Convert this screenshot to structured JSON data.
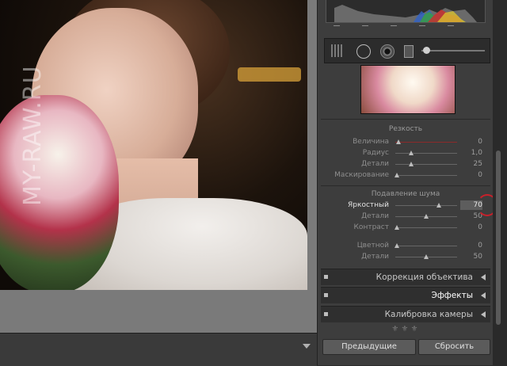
{
  "watermark": "MY-RAW.RU",
  "sharpening": {
    "title": "Резкость",
    "rows": [
      {
        "label": "Величина",
        "value": "0",
        "pos": 0.05,
        "red": true
      },
      {
        "label": "Радиус",
        "value": "1,0",
        "pos": 0.25,
        "red": false
      },
      {
        "label": "Детали",
        "value": "25",
        "pos": 0.25,
        "red": false
      },
      {
        "label": "Маскирование",
        "value": "0",
        "pos": 0.02,
        "red": false
      }
    ]
  },
  "noise": {
    "title": "Подавление шума",
    "rows": [
      {
        "label": "Яркостный",
        "value": "70",
        "pos": 0.7,
        "active": true
      },
      {
        "label": "Детали",
        "value": "50",
        "pos": 0.5,
        "active": false
      },
      {
        "label": "Контраст",
        "value": "0",
        "pos": 0.02,
        "active": false
      },
      {
        "label": "Цветной",
        "value": "0",
        "pos": 0.02,
        "active": false
      },
      {
        "label": "Детали",
        "value": "50",
        "pos": 0.5,
        "active": false
      }
    ]
  },
  "sections": [
    {
      "label": "Коррекция объектива",
      "bright": false
    },
    {
      "label": "Эффекты",
      "bright": true
    },
    {
      "label": "Калибровка камеры",
      "bright": false
    }
  ],
  "buttons": {
    "previous": "Предыдущие",
    "reset": "Сбросить"
  },
  "colors": {
    "highlight": "#c8202a"
  }
}
